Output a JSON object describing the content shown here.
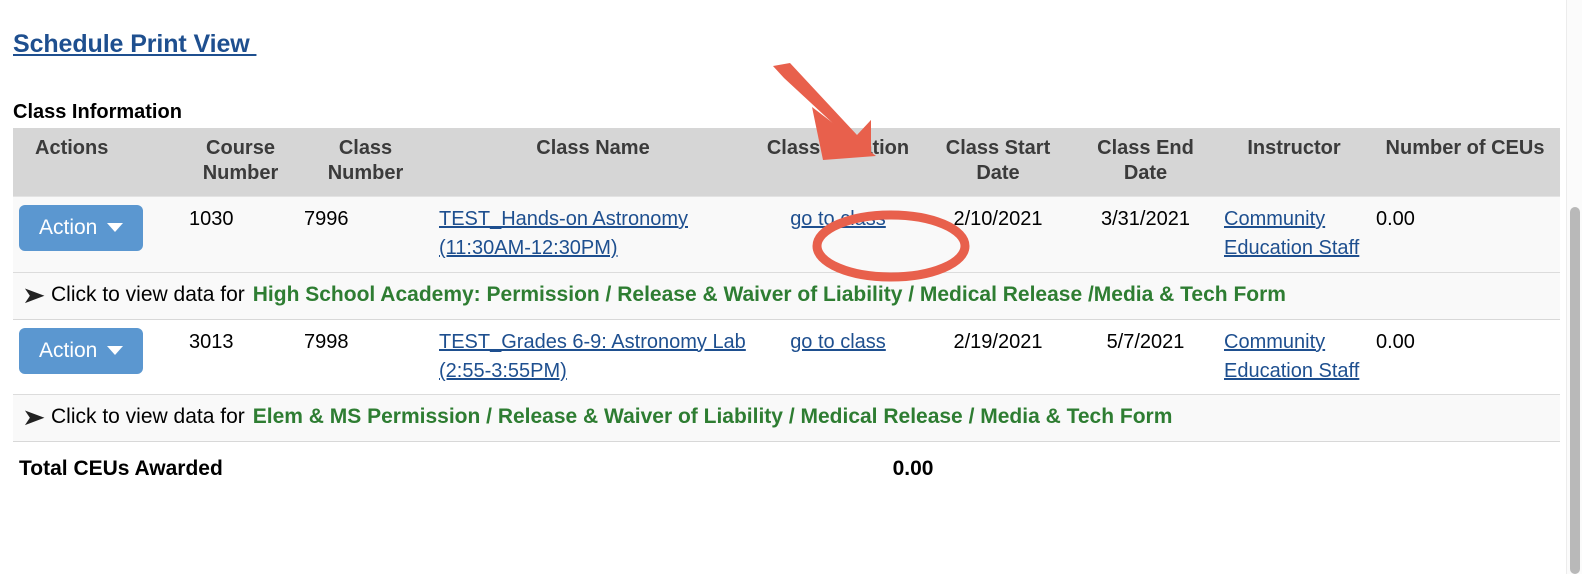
{
  "top_link": {
    "label": "Schedule Print View "
  },
  "section": {
    "title": "Class Information"
  },
  "table": {
    "headers": {
      "actions": "Actions",
      "course_number": "Course Number",
      "class_number": "Class Number",
      "class_name": "Class Name",
      "class_location": "Class Location",
      "class_start_date": "Class Start Date",
      "class_end_date": "Class End Date",
      "instructor": "Instructor",
      "number_of_ceus": "Number of CEUs"
    },
    "rows": [
      {
        "action_label": "Action",
        "course_number": "1030",
        "class_number": "7996",
        "class_name": "TEST_Hands-on Astronomy (11:30AM-12:30PM)",
        "class_location": "go to class",
        "class_start_date": "2/10/2021",
        "class_end_date": "3/31/2021",
        "instructor": "Community Education Staff",
        "ceus": "0.00"
      },
      {
        "action_label": "Action",
        "course_number": "3013",
        "class_number": "7998",
        "class_name": "TEST_Grades 6-9: Astronomy Lab (2:55-3:55PM)",
        "class_location": "go to class",
        "class_start_date": "2/19/2021",
        "class_end_date": "5/7/2021",
        "instructor": "Community Education Staff",
        "ceus": "0.00"
      }
    ],
    "expand_rows": [
      {
        "chevron": "➤",
        "prompt": "Click to view data for",
        "form_name": "High School Academy: Permission / Release & Waiver of Liability / Medical Release /Media & Tech Form"
      },
      {
        "chevron": "➤",
        "prompt": "Click to view data for",
        "form_name": "Elem & MS Permission / Release & Waiver of Liability / Medical Release / Media & Tech Form"
      }
    ],
    "total": {
      "label": "Total CEUs Awarded",
      "value": "0.00"
    }
  },
  "annotations": {
    "arrow": {
      "name": "red-arrow-annotation",
      "color": "#e8604c"
    },
    "ellipse": {
      "name": "red-ellipse-annotation",
      "color": "#e8604c"
    }
  },
  "colors": {
    "link_blue": "#1e4f8f",
    "header_gray": "#d6d6d6",
    "action_button_blue": "#5b97d0",
    "form_green": "#2e7d32",
    "annotation_red": "#e8604c"
  }
}
